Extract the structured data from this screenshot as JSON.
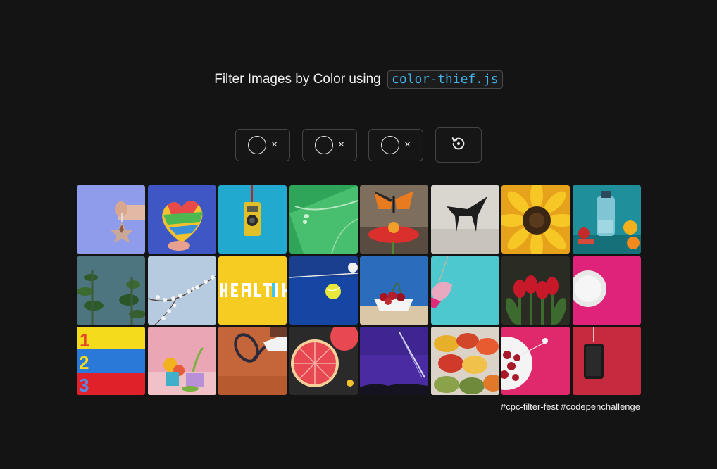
{
  "header": {
    "title_prefix": "Filter Images by Color using",
    "code_label": "color-thief.js"
  },
  "filters": {
    "swatches": [
      {
        "remove_symbol": "×"
      },
      {
        "remove_symbol": "×"
      },
      {
        "remove_symbol": "×"
      }
    ],
    "reset_icon": "reset-icon"
  },
  "gallery": {
    "images": [
      {
        "subject": "hand holding star ornament",
        "dominant_color": "#8c9be8"
      },
      {
        "subject": "rainbow felt heart",
        "dominant_color": "#4d62c9"
      },
      {
        "subject": "yellow camera on cyan",
        "dominant_color": "#21a8cf"
      },
      {
        "subject": "green leaf with droplets",
        "dominant_color": "#2fa55a"
      },
      {
        "subject": "butterfly on red flower",
        "dominant_color": "#7a6a5c"
      },
      {
        "subject": "black sculpture on white",
        "dominant_color": "#d7d3cc"
      },
      {
        "subject": "yellow sunflower",
        "dominant_color": "#f3b61c"
      },
      {
        "subject": "water bottle with fruit",
        "dominant_color": "#1f8e9a"
      },
      {
        "subject": "green succulent",
        "dominant_color": "#486f78"
      },
      {
        "subject": "white blossoms",
        "dominant_color": "#b3c8df"
      },
      {
        "subject": "health lettering on yellow",
        "dominant_color": "#f6cc22"
      },
      {
        "subject": "tennis ball on blue court",
        "dominant_color": "#1344a1"
      },
      {
        "subject": "cherries in bowl by pool",
        "dominant_color": "#2a69b8"
      },
      {
        "subject": "tag on turquoise",
        "dominant_color": "#49c7cd"
      },
      {
        "subject": "red tulips",
        "dominant_color": "#2f2f26"
      },
      {
        "subject": "white plate on magenta",
        "dominant_color": "#e0237a"
      },
      {
        "subject": "numbers 1 2 3 on stripes",
        "dominant_color": "#f4dd1c"
      },
      {
        "subject": "pastel still life",
        "dominant_color": "#e9a5b3"
      },
      {
        "subject": "tennis player on clay",
        "dominant_color": "#c4643a"
      },
      {
        "subject": "grapefruit halves",
        "dominant_color": "#e84c52"
      },
      {
        "subject": "purple night sky",
        "dominant_color": "#4a2aa0"
      },
      {
        "subject": "colorful pasta nests",
        "dominant_color": "#d8cfc4"
      },
      {
        "subject": "raspberries on pink",
        "dominant_color": "#e0296d"
      },
      {
        "subject": "phone on red",
        "dominant_color": "#c52a3e"
      }
    ]
  },
  "footer": {
    "hashtags": "#cpc-filter-fest #codepenchallenge"
  }
}
